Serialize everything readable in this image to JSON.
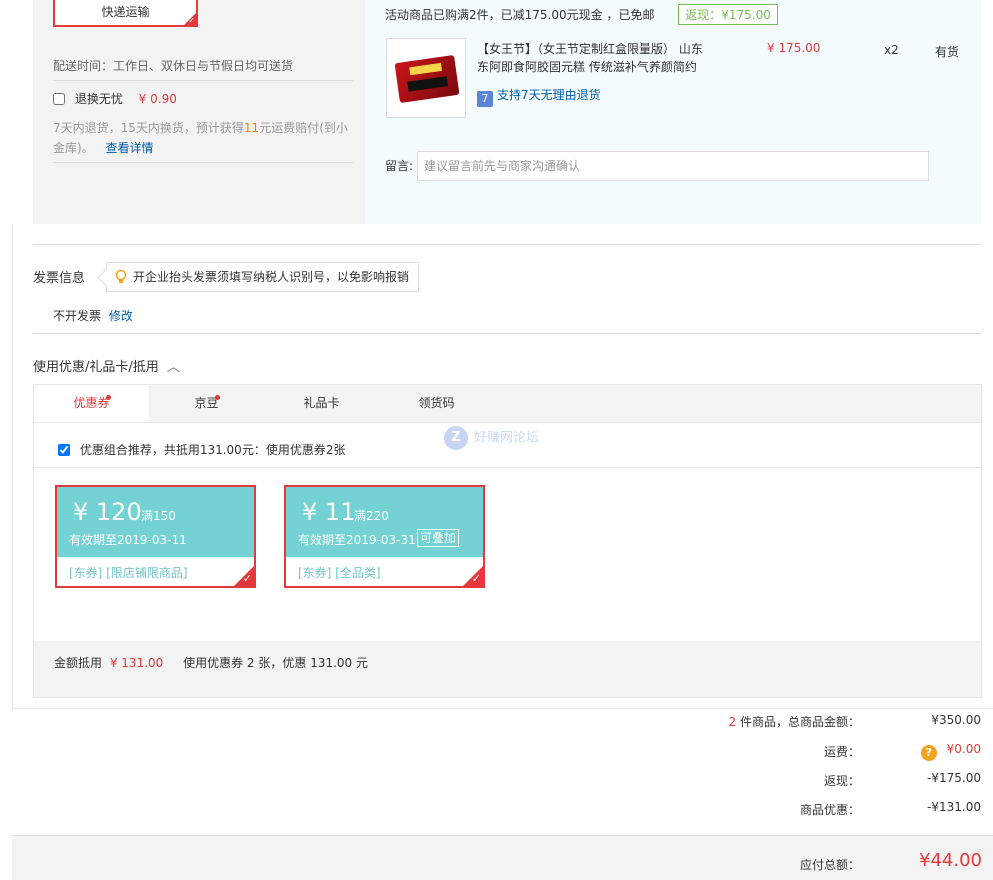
{
  "shipping": {
    "method_label": "快递运输",
    "delivery_time": "配送时间：工作日、双休日与节假日均可送货",
    "return_insurance_label": "退换无忧",
    "return_insurance_price": "¥ 0.90",
    "return_desc_1": "7天内退货，15天内换货，预计获得",
    "return_desc_highlight": "11",
    "return_desc_2": "元运费赔付(到小",
    "return_desc_3": "金库)。",
    "details_link": "查看详情"
  },
  "order_item": {
    "promo_text": "活动商品已购满2件，已减175.00元现金 ，已免邮",
    "cashback_tag": "返现：¥175.00",
    "title_line1": "【女王节】（女王节定制红盒限量版） 山东",
    "title_line2": "东阿即食阿胶固元糕 传统滋补气养颜简约",
    "price": "¥ 175.00",
    "quantity": "x2",
    "stock": "有货",
    "seven_day_icon": "7",
    "seven_day_text": "支持7天无理由退货",
    "message_label": "留言:",
    "message_placeholder": "建议留言前先与商家沟通确认"
  },
  "invoice": {
    "title": "发票信息",
    "tip": "开企业抬头发票须填写纳税人识别号，以免影响报销",
    "value": "不开发票",
    "edit_link": "修改"
  },
  "discounts": {
    "title": "使用优惠/礼品卡/抵用",
    "tabs": [
      {
        "label": "优惠券",
        "active": true,
        "dot": true
      },
      {
        "label": "京豆",
        "active": false,
        "dot": true
      },
      {
        "label": "礼品卡",
        "active": false,
        "dot": false
      },
      {
        "label": "领货码",
        "active": false,
        "dot": false
      }
    ],
    "combo_text": "优惠组合推荐，共抵用131.00元：使用优惠券2张",
    "coupons": [
      {
        "amount": "¥ 120",
        "condition": "满150",
        "expiry": "有效期至2019-03-11",
        "stackable": "",
        "tags": "[东券]  [限店铺限商品]"
      },
      {
        "amount": "¥ 11",
        "condition": "满220",
        "expiry": "有效期至2019-03-31",
        "stackable": "可叠加",
        "tags": "[东券]  [全品类]"
      }
    ],
    "footer_label": "金额抵用",
    "footer_amount": "¥ 131.00",
    "footer_desc": "使用优惠券 2 张，优惠 131.00 元"
  },
  "watermark": {
    "icon": "Z",
    "text": "好赚网论坛"
  },
  "summary": {
    "count": "2",
    "count_label": "件商品，总商品金额：",
    "total_goods": "¥350.00",
    "shipping_label": "运费：",
    "shipping_icon": "?",
    "shipping_value": "¥0.00",
    "cashback_label": "返现：",
    "cashback_value": "-¥175.00",
    "discount_label": "商品优惠：",
    "discount_value": "-¥131.00",
    "payable_label": "应付总额：",
    "payable_value": "¥44.00"
  },
  "colors": {
    "accent_red": "#e4393c",
    "link_blue": "#005ea7",
    "coupon_teal": "#74d2d4",
    "cashback_green": "#7abd54"
  }
}
